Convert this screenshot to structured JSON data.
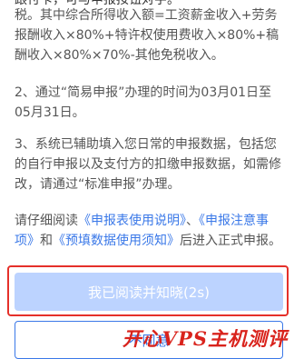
{
  "notice": {
    "cutoff_line": "跟付卡，可与申报按钮对字。",
    "income_rule": "税。其中综合所得收入额=工资薪金收入+劳务报酬收入×80%+特许权使用费收入×80%+稿酬收入×80%×70%-其他免税收入。",
    "date_rule": "2、通过“简易申报”办理的时间为03月01日至05月31日。",
    "system_rule": "3、系统已辅助填入您日常的申报数据，包括您的自行申报以及支付方的扣缴申报数据，如需修改，请通过“标准申报”办理。",
    "read_prefix": "请仔细阅读",
    "link_instructions": "《申报表使用说明》",
    "sep1": "、",
    "link_precautions": "《申报注意事项》",
    "and_word": "和",
    "link_data_notice": "《预填数据使用须知》",
    "read_suffix": "后进入正式申报。"
  },
  "buttons": {
    "confirm_label": "我已阅读并知晓(2s)",
    "disagree_label": "不同意"
  },
  "watermark": {
    "text": "开心VPS主机测评"
  },
  "colors": {
    "link": "#3a78e8",
    "confirm_bg": "#bcd3ff",
    "highlight_border": "#e5302a",
    "watermark": "#d9231c"
  }
}
